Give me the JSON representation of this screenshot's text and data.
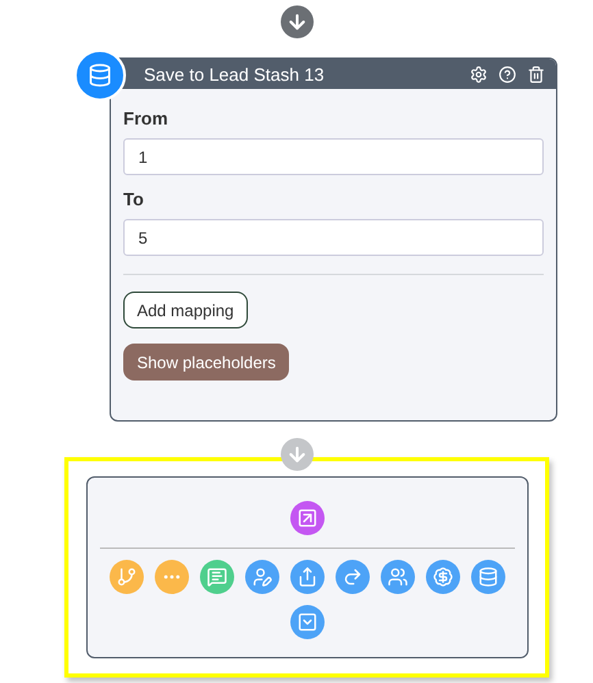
{
  "step": {
    "title": "Save to Lead Stash 13",
    "fields": [
      {
        "label": "From",
        "value": "1"
      },
      {
        "label": "To",
        "value": "5"
      }
    ],
    "buttons": [
      {
        "label": "Add mapping",
        "kind": "outline"
      },
      {
        "label": "Show placeholders",
        "kind": "filled"
      }
    ]
  },
  "palette": {
    "highlighted": true,
    "top": [
      {
        "color": "#c457f2"
      }
    ],
    "actions": [
      {
        "color": "#fbb84a"
      },
      {
        "color": "#fbb84a"
      },
      {
        "color": "#4fcf8d"
      },
      {
        "color": "#4da3f7"
      },
      {
        "color": "#4da3f7"
      },
      {
        "color": "#4da3f7"
      },
      {
        "color": "#4da3f7"
      },
      {
        "color": "#4da3f7"
      },
      {
        "color": "#4da3f7"
      },
      {
        "color": "#4da3f7"
      }
    ]
  }
}
